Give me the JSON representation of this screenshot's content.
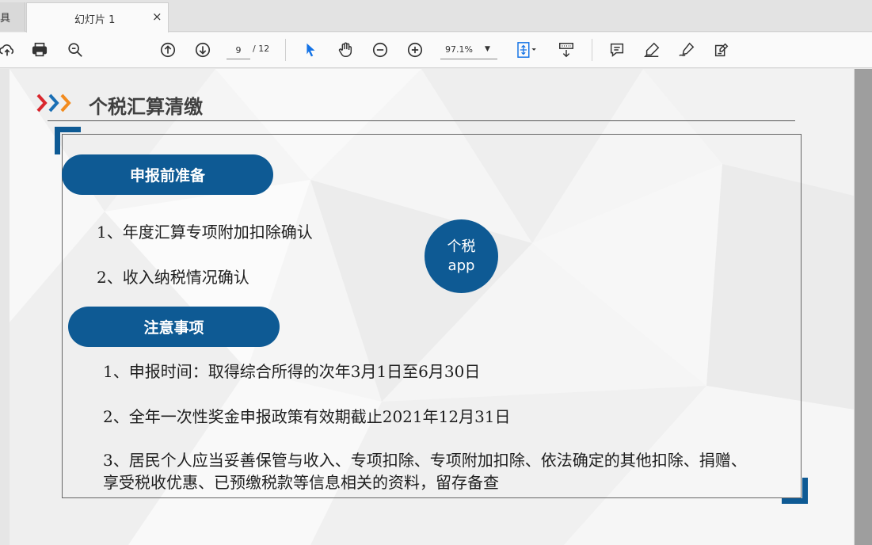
{
  "tabs": {
    "prev_fragment": "具",
    "active_title": "幻灯片 1",
    "close_glyph": "×"
  },
  "toolbar": {
    "page_current": "9",
    "page_total": "/ 12",
    "zoom": "97.1%"
  },
  "slide": {
    "title": "个税汇算清缴",
    "section1_label": "申报前准备",
    "section1_items": [
      "1、年度汇算专项附加扣除确认",
      "2、收入纳税情况确认"
    ],
    "circle_line1": "个税",
    "circle_line2": "app",
    "section2_label": "注意事项",
    "section2_items": [
      "1、申报时间：取得综合所得的次年3月1日至6月30日",
      "2、全年一次性奖金申报政策有效期截止2021年12月31日",
      "3、居民个人应当妥善保管与收入、专项扣除、专项附加扣除、依法确定的其他扣除、捐赠、享受税收优惠、已预缴税款等信息相关的资料，留存备查"
    ]
  },
  "colors": {
    "accent": "#0e5a94",
    "chevron_red": "#d9272e",
    "chevron_blue": "#1a6fb5",
    "chevron_orange": "#f28b1e",
    "tool_blue": "#1473e6"
  }
}
